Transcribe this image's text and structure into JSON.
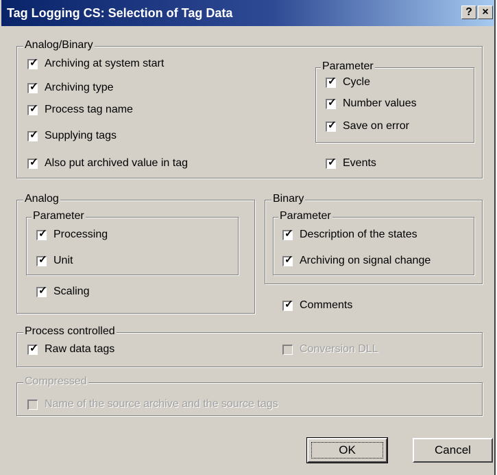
{
  "window": {
    "title": "Tag Logging CS: Selection of Tag Data",
    "help_glyph": "?",
    "close_glyph": "×"
  },
  "analog_binary": {
    "legend": "Analog/Binary",
    "items": [
      {
        "label": "Archiving at system start",
        "checked": true
      },
      {
        "label": "Archiving type",
        "checked": true
      },
      {
        "label": "Process tag name",
        "checked": true
      },
      {
        "label": "Supplying tags",
        "checked": true
      },
      {
        "label": "Also put archived value in tag",
        "checked": true
      }
    ],
    "parameter": {
      "legend": "Parameter",
      "items": [
        {
          "label": "Cycle",
          "checked": true
        },
        {
          "label": "Number values",
          "checked": true
        },
        {
          "label": "Save on error",
          "checked": true
        }
      ]
    },
    "events": {
      "label": "Events",
      "checked": true
    }
  },
  "analog": {
    "legend": "Analog",
    "parameter": {
      "legend": "Parameter",
      "items": [
        {
          "label": "Processing",
          "checked": true
        },
        {
          "label": "Unit",
          "checked": true
        }
      ]
    },
    "scaling": {
      "label": "Scaling",
      "checked": true
    }
  },
  "binary": {
    "legend": "Binary",
    "parameter": {
      "legend": "Parameter",
      "items": [
        {
          "label": "Description of the states",
          "checked": true
        },
        {
          "label": "Archiving on signal change",
          "checked": true
        }
      ]
    }
  },
  "comments": {
    "label": "Comments",
    "checked": true
  },
  "process_controlled": {
    "legend": "Process controlled",
    "raw_data": {
      "label": "Raw data tags",
      "checked": true
    },
    "conversion_dll": {
      "label": "Conversion DLL",
      "checked": false,
      "disabled": true
    }
  },
  "compressed": {
    "legend": "Compressed",
    "disabled": true,
    "source": {
      "label": "Name of the source archive and the source tags",
      "checked": false,
      "disabled": true
    }
  },
  "buttons": {
    "ok": "OK",
    "cancel": "Cancel"
  },
  "check_glyph": "✓"
}
